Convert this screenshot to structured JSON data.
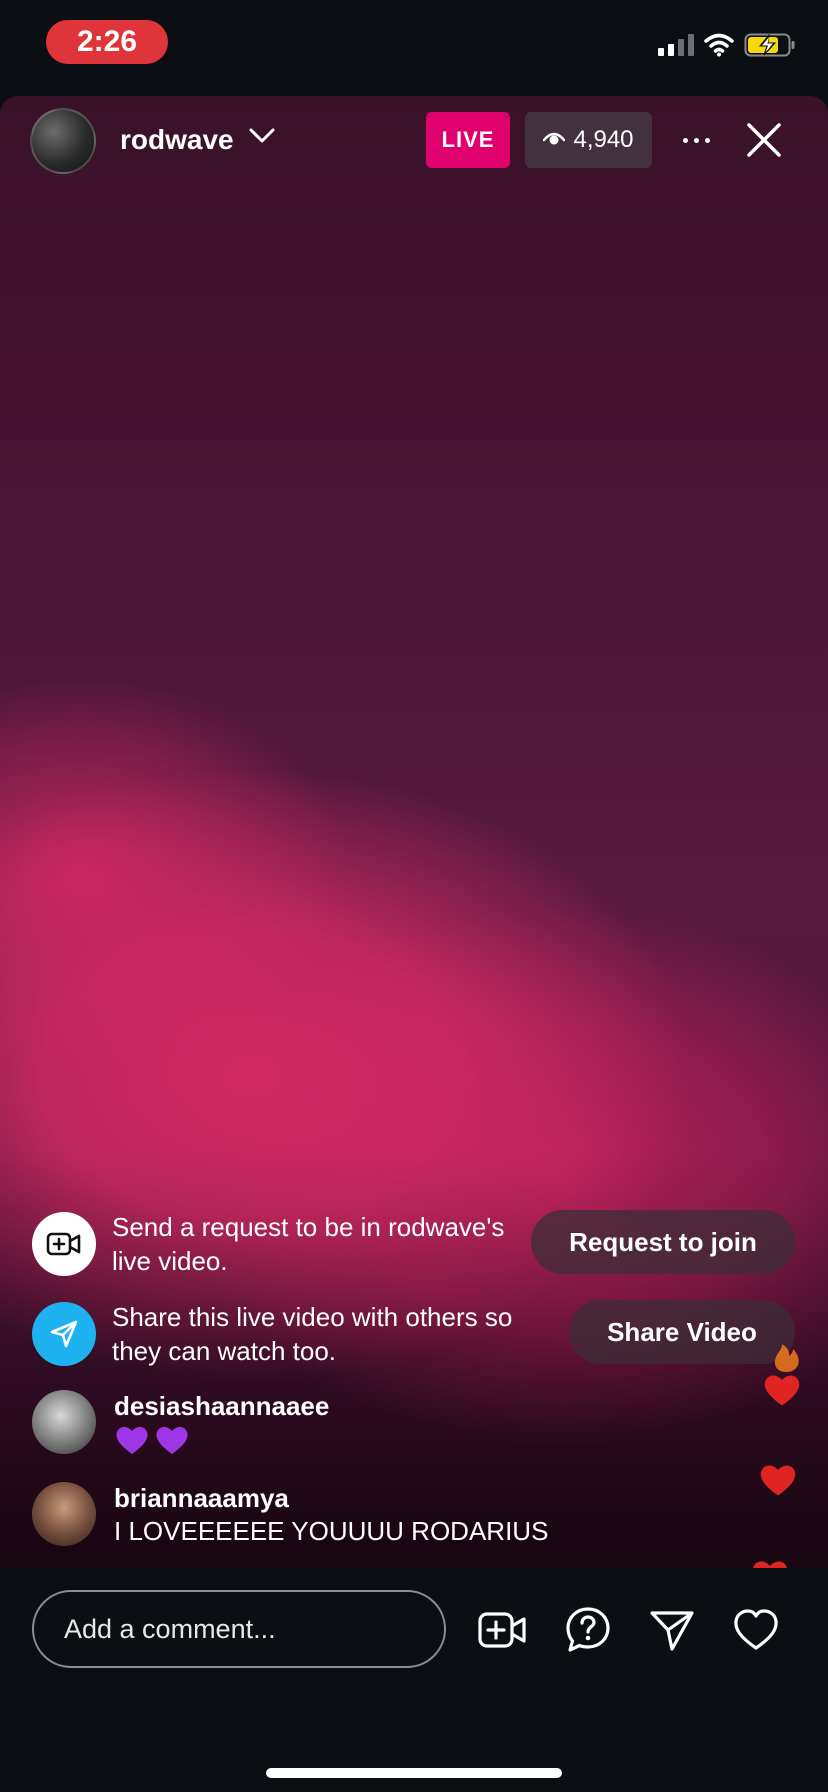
{
  "status_bar": {
    "time": "2:26",
    "icons": [
      "cellular-signal-icon",
      "wifi-icon",
      "battery-charging-icon"
    ]
  },
  "header": {
    "username": "rodwave",
    "live_label": "LIVE",
    "viewer_count": "4,940",
    "icons": [
      "avatar",
      "chevron-down-icon",
      "eye-icon",
      "more-icon",
      "close-icon"
    ]
  },
  "prompts": {
    "request": {
      "text": "Send a request to be in rodwave's live video.",
      "button": "Request to join"
    },
    "share": {
      "text": "Share this live video with others so they can watch too.",
      "button": "Share Video"
    }
  },
  "comments": [
    {
      "user": "desiashaannaaee",
      "text": "💜💜"
    },
    {
      "user": "briannaaamya",
      "text": "I LOVEEEEEE YOUUUU RODARIUS"
    }
  ],
  "bottom_bar": {
    "comment_placeholder": "Add a comment...",
    "icons": [
      "video-add-icon",
      "question-icon",
      "send-icon",
      "heart-icon"
    ]
  },
  "colors": {
    "live_badge": "#e0006e",
    "time_pill": "#e0343b",
    "share_icon_bg": "#1fb2f0",
    "heart_red": "#e02424",
    "heart_purple": "#a035e8"
  }
}
